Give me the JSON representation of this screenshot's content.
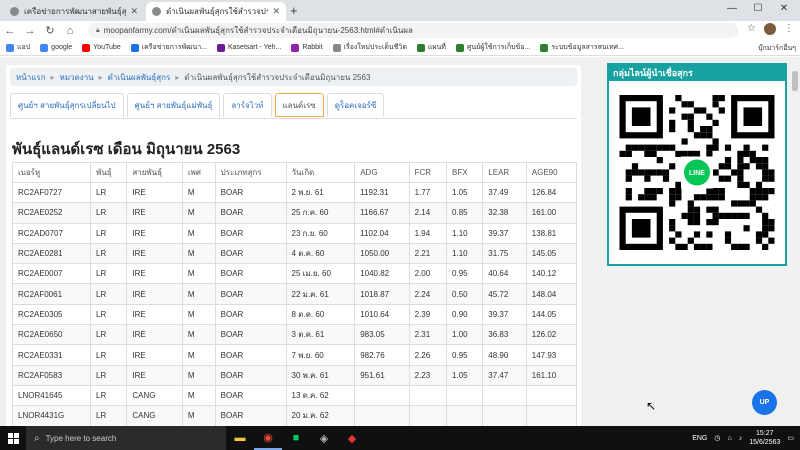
{
  "browser": {
    "tabs": [
      {
        "title": "เครือข่ายการพัฒนาสายพันธุ์สุกร ศู..."
      },
      {
        "title": "ดำเนินผลพันธุ์สุกรใช้สำรวจประจำเดือนมิ..."
      }
    ],
    "url": "moopanfarmy.com/ดำเนินผลพันธุ์สุกรใช้สำรวจประจำเดือนมิถุนายน-2563.html#ดำเนินผล",
    "bookmarks": [
      {
        "label": "แอป",
        "icon": "apps-icon",
        "color": "#4285f4"
      },
      {
        "label": "google",
        "icon": "google-icon",
        "color": "#4285f4"
      },
      {
        "label": "YouTube",
        "icon": "youtube-icon",
        "color": "#ff0000"
      },
      {
        "label": "เครือข่ายการพัฒนา...",
        "icon": "bookmark-icon",
        "color": "#1a73e8"
      },
      {
        "label": "Kasetsart - Yeh...",
        "icon": "bookmark-icon",
        "color": "#6a1b9a"
      },
      {
        "label": "Rabbit",
        "icon": "bookmark-icon",
        "color": "#8e24aa"
      },
      {
        "label": "เรื่องใหม่ประเด็นชีวิต",
        "icon": "bookmark-icon",
        "color": "#888888"
      },
      {
        "label": "แผนที่",
        "icon": "bookmark-icon",
        "color": "#2e7d32"
      },
      {
        "label": "ศูนย์ผู้ใช้การเก็บข้อ...",
        "icon": "bookmark-icon",
        "color": "#2e7d32"
      },
      {
        "label": "ระบบข้อมูลสารสนเทศ...",
        "icon": "bookmark-icon",
        "color": "#2e7d32"
      }
    ],
    "other_bookmarks": "บุ๊กมาร์กอื่นๆ"
  },
  "breadcrumb": {
    "items": [
      "หน้าแรก",
      "หมวดงาน",
      "ดำเนินผลพันธุ์สุกร",
      "ดำเนินผลพันธุ์สุกรใช้สำรวจประจำเดือนมิถุนายน 2563"
    ]
  },
  "page_tabs": [
    {
      "label": "ศูนย์ฯ สายพันธุ์สุกรเปลี่ยนไป",
      "active": false
    },
    {
      "label": "ศูนย์ฯ สายพันธุ์แม่พันธุ์",
      "active": false
    },
    {
      "label": "ลาร์จไวท์",
      "active": false
    },
    {
      "label": "แลนด์เรซ",
      "active": true
    },
    {
      "label": "ดูร็อคเจอร์ซี",
      "active": false
    }
  ],
  "heading": "พันธุ์แลนด์เรซ เดือน มิถุนายน 2563",
  "table": {
    "headers": [
      "เบอร์หู",
      "พันธุ์",
      "สายพันธุ์",
      "เพศ",
      "ประเภทสุกร",
      "วันเกิด",
      "ADG",
      "FCR",
      "BFX",
      "LEAR",
      "AGE90"
    ],
    "rows": [
      [
        "RC2AF0727",
        "LR",
        "IRE",
        "M",
        "BOAR",
        "2 พ.ย. 61",
        "1192.31",
        "1.77",
        "1.05",
        "37.49",
        "126.84"
      ],
      [
        "RC2AE0252",
        "LR",
        "IRE",
        "M",
        "BOAR",
        "25 ก.ค. 60",
        "1166.67",
        "2.14",
        "0.85",
        "32.38",
        "161.00"
      ],
      [
        "RC2AD0707",
        "LR",
        "IRE",
        "M",
        "BOAR",
        "23 ก.ย. 60",
        "1102.04",
        "1.94",
        "1.10",
        "39.37",
        "138.81"
      ],
      [
        "RC2AE0281",
        "LR",
        "IRE",
        "M",
        "BOAR",
        "4 ต.ค. 60",
        "1050.00",
        "2.21",
        "1.10",
        "31.75",
        "145.05"
      ],
      [
        "RC2AE0007",
        "LR",
        "IRE",
        "M",
        "BOAR",
        "25 เม.ย. 60",
        "1040.82",
        "2.00",
        "0.95",
        "40.64",
        "140.12"
      ],
      [
        "RC2AF0061",
        "LR",
        "IRE",
        "M",
        "BOAR",
        "22 ม.ค. 61",
        "1018.87",
        "2.24",
        "0.50",
        "45.72",
        "148.04"
      ],
      [
        "RC2AE0305",
        "LR",
        "IRE",
        "M",
        "BOAR",
        "8 ต.ค. 60",
        "1010.64",
        "2.39",
        "0.90",
        "39.37",
        "144.05"
      ],
      [
        "RC2AE0650",
        "LR",
        "IRE",
        "M",
        "BOAR",
        "3 ต.ค. 61",
        "983.05",
        "2.31",
        "1.00",
        "36.83",
        "126.02"
      ],
      [
        "RC2AE0331",
        "LR",
        "IRE",
        "M",
        "BOAR",
        "7 พ.ย. 60",
        "982.76",
        "2.26",
        "0.95",
        "48.90",
        "147.93"
      ],
      [
        "RC2AF0583",
        "LR",
        "IRE",
        "M",
        "BOAR",
        "30 พ.ค. 61",
        "951.61",
        "2.23",
        "1.05",
        "37.47",
        "161.10"
      ],
      [
        "LNOR41645",
        "LR",
        "CANG",
        "M",
        "BOAR",
        "13 ต.ค. 62",
        "",
        "",
        "",
        "",
        ""
      ],
      [
        "LNOR4431G",
        "LR",
        "CANG",
        "M",
        "BOAR",
        "20 ม.ค. 62",
        "",
        "",
        "",
        "",
        ""
      ],
      [
        "",
        "",
        "",
        "",
        "",
        "",
        "",
        "",
        "",
        "",
        ""
      ]
    ]
  },
  "sidebar": {
    "title": "กลุ่มไลน์ผู้นำเชื่อสุกร",
    "line_label": "LINE"
  },
  "up_button": "UP",
  "taskbar": {
    "search_placeholder": "Type here to search",
    "lang": "ENG",
    "time": "15:27",
    "date": "15/6/2563"
  }
}
